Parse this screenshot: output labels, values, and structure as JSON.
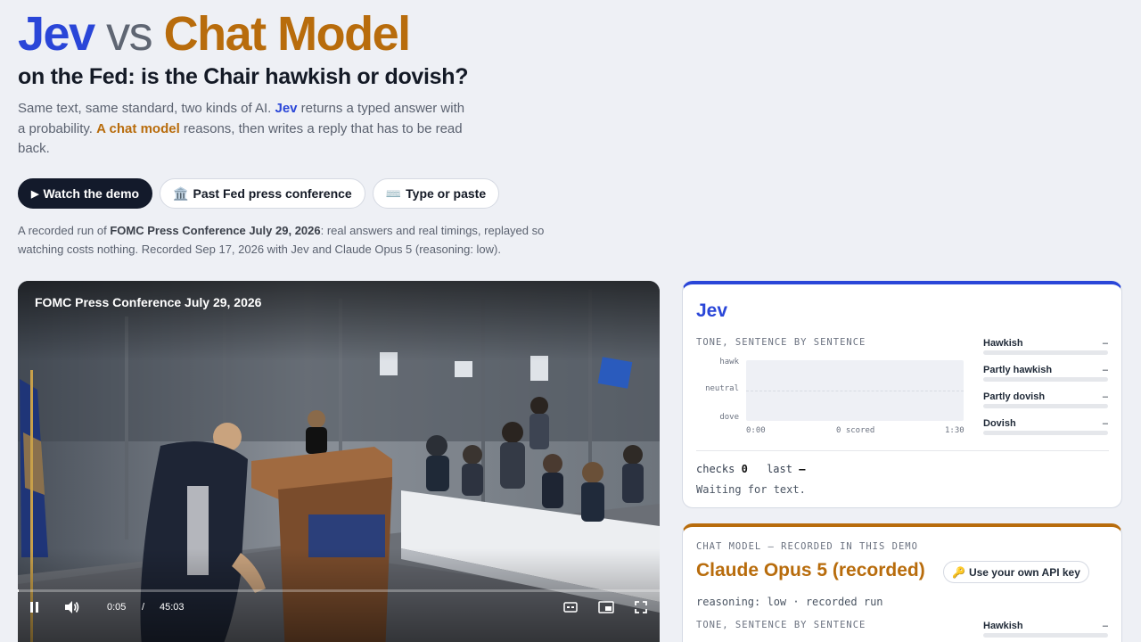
{
  "header": {
    "title_jev": "Jev",
    "title_vs": "vs",
    "title_chat": "Chat Model",
    "subtitle": "on the Fed: is the Chair hawkish or dovish?"
  },
  "intro": {
    "part1": "Same text, same standard, two kinds of AI. ",
    "jev": "Jev",
    "part2": " returns a typed answer with a probability. ",
    "chat": "A chat model",
    "part3": " reasons, then writes a reply that has to be read back."
  },
  "buttons": {
    "watch_icon": "▶",
    "watch": "Watch the demo",
    "past_icon": "🏛️",
    "past": "Past Fed press conference",
    "type_icon": "⌨️",
    "type": "Type or paste"
  },
  "note": {
    "prefix": "A recorded run of ",
    "event": "FOMC Press Conference July 29, 2026",
    "suffix": ": real answers and real timings, replayed so watching costs nothing. Recorded Sep 17, 2026 with Jev and Claude Opus 5 (reasoning: low)."
  },
  "video": {
    "title": "FOMC Press Conference July 29, 2026",
    "current_time": "0:05",
    "separator": "/",
    "duration": "45:03",
    "progress": 0.002,
    "icons": [
      "pause-icon",
      "volume-icon",
      "captions-icon",
      "picture-in-picture-icon",
      "fullscreen-icon"
    ]
  },
  "jev_panel": {
    "name": "Jev",
    "section_label": "TONE, SENTENCE BY SENTENCE",
    "chart_y_labels": [
      "hawk",
      "neutral",
      "dove"
    ],
    "chart_x_start": "0:00",
    "chart_x_mid": "0 scored",
    "chart_x_end": "1:30",
    "bars": [
      {
        "label": "Hawkish",
        "value": "–"
      },
      {
        "label": "Partly hawkish",
        "value": "–"
      },
      {
        "label": "Partly dovish",
        "value": "–"
      },
      {
        "label": "Dovish",
        "value": "–"
      }
    ],
    "checks_label": "checks",
    "checks_value": "0",
    "last_label": "last",
    "last_value": "–",
    "status": "Waiting for text."
  },
  "chat_panel": {
    "kicker": "CHAT MODEL — RECORDED IN THIS DEMO",
    "name": "Claude Opus 5 (recorded)",
    "key_icon": "🔑",
    "key_button": "Use your own API key",
    "reasoning": "reasoning: low · recorded run",
    "section_label": "TONE, SENTENCE BY SENTENCE",
    "first_bar_label": "Hawkish",
    "first_bar_value": "–"
  },
  "colors": {
    "jev": "#2a46d8",
    "chat": "#b86c0c",
    "dark": "#131a2b",
    "background": "#eef0f5"
  }
}
